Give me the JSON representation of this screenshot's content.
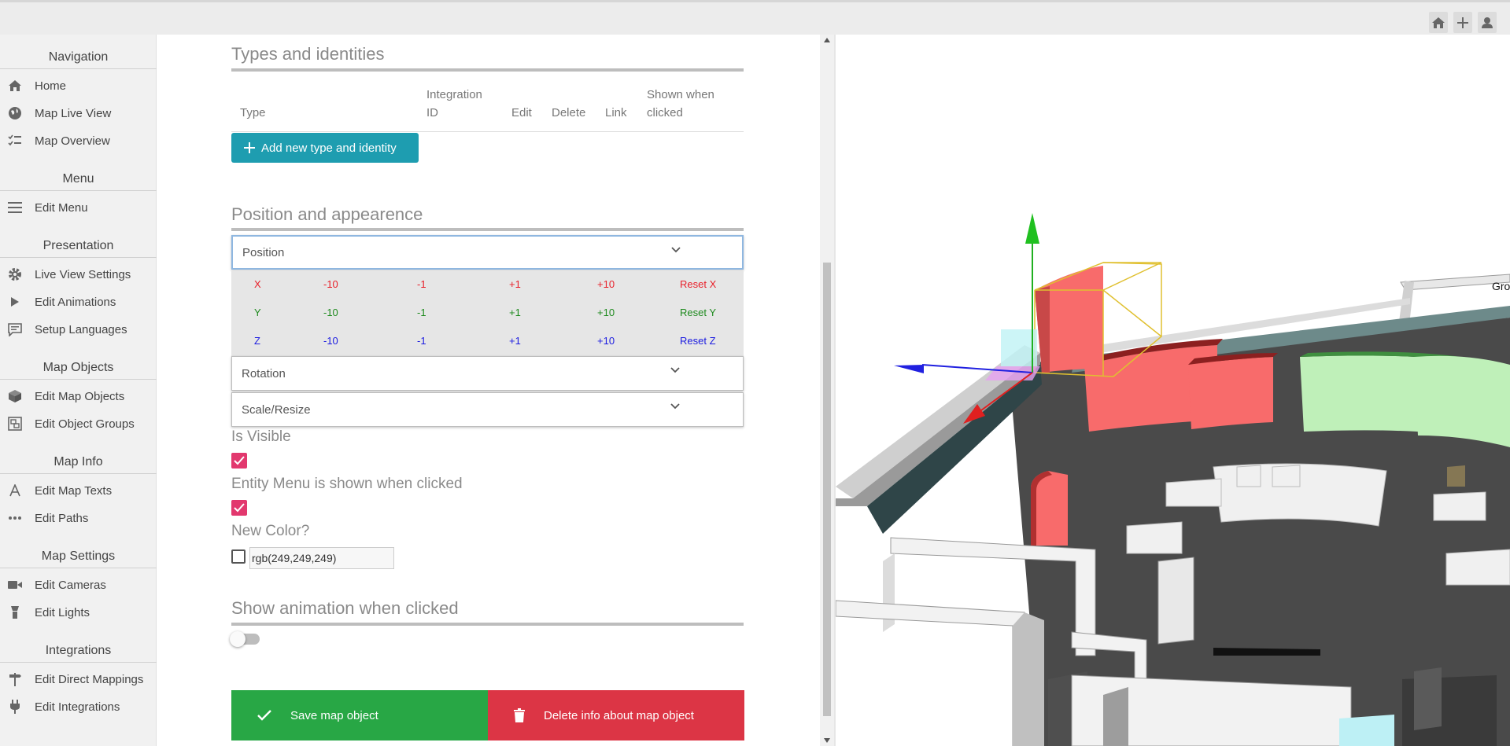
{
  "topbar": {
    "icons": [
      "home-icon",
      "plus-icon",
      "user-icon"
    ]
  },
  "sidebar": {
    "sections": [
      {
        "title": "Navigation",
        "items": [
          {
            "label": "Home",
            "icon": "home-icon"
          },
          {
            "label": "Map Live View",
            "icon": "globe-icon"
          },
          {
            "label": "Map Overview",
            "icon": "list-check-icon"
          }
        ]
      },
      {
        "title": "Menu",
        "items": [
          {
            "label": "Edit Menu",
            "icon": "bars-icon"
          }
        ]
      },
      {
        "title": "Presentation",
        "items": [
          {
            "label": "Live View Settings",
            "icon": "gear-icon"
          },
          {
            "label": "Edit Animations",
            "icon": "play-icon"
          },
          {
            "label": "Setup Languages",
            "icon": "comment-icon"
          }
        ]
      },
      {
        "title": "Map Objects",
        "items": [
          {
            "label": "Edit Map Objects",
            "icon": "cube-icon"
          },
          {
            "label": "Edit Object Groups",
            "icon": "object-group-icon"
          }
        ]
      },
      {
        "title": "Map Info",
        "items": [
          {
            "label": "Edit Map Texts",
            "icon": "font-icon"
          },
          {
            "label": "Edit Paths",
            "icon": "ellipsis-icon"
          }
        ]
      },
      {
        "title": "Map Settings",
        "items": [
          {
            "label": "Edit Cameras",
            "icon": "video-icon"
          },
          {
            "label": "Edit Lights",
            "icon": "flashlight-icon"
          }
        ]
      },
      {
        "title": "Integrations",
        "items": [
          {
            "label": "Edit Direct Mappings",
            "icon": "signpost-icon"
          },
          {
            "label": "Edit Integrations",
            "icon": "plug-icon"
          }
        ]
      }
    ]
  },
  "main": {
    "types_title": "Types and identities",
    "table_headers": {
      "type": "Type",
      "integration_1": "Integration",
      "integration_2": "ID",
      "edit": "Edit",
      "delete": "Delete",
      "link": "Link",
      "shown_1": "Shown when",
      "shown_2": "clicked"
    },
    "add_type_label": "Add new type and identity",
    "position_title": "Position and appearence",
    "acc_position": "Position",
    "acc_rotation": "Rotation",
    "acc_scale": "Scale/Resize",
    "position_rows": [
      {
        "axis": "X",
        "m10": "-10",
        "m1": "-1",
        "p1": "+1",
        "p10": "+10",
        "reset": "Reset X",
        "color": "#e8202a"
      },
      {
        "axis": "Y",
        "m10": "-10",
        "m1": "-1",
        "p1": "+1",
        "p10": "+10",
        "reset": "Reset Y",
        "color": "#1e8a1e"
      },
      {
        "axis": "Z",
        "m10": "-10",
        "m1": "-1",
        "p1": "+1",
        "p10": "+10",
        "reset": "Reset Z",
        "color": "#1a1ae0"
      }
    ],
    "is_visible_label": "Is Visible",
    "is_visible": true,
    "entity_menu_label": "Entity Menu is shown when clicked",
    "entity_menu": true,
    "new_color_label": "New Color?",
    "new_color_checked": false,
    "color_value": "rgb(249,249,249)",
    "show_animation_title": "Show animation when clicked",
    "show_animation": false,
    "save_label": "Save map object",
    "delete_label": "Delete info about map object"
  },
  "viewport": {
    "label_partial": "Gro"
  },
  "colors": {
    "accent_teal": "#1e9db0",
    "save_green": "#28a745",
    "delete_red": "#dc3545",
    "checkbox_pink": "#e2386e"
  }
}
